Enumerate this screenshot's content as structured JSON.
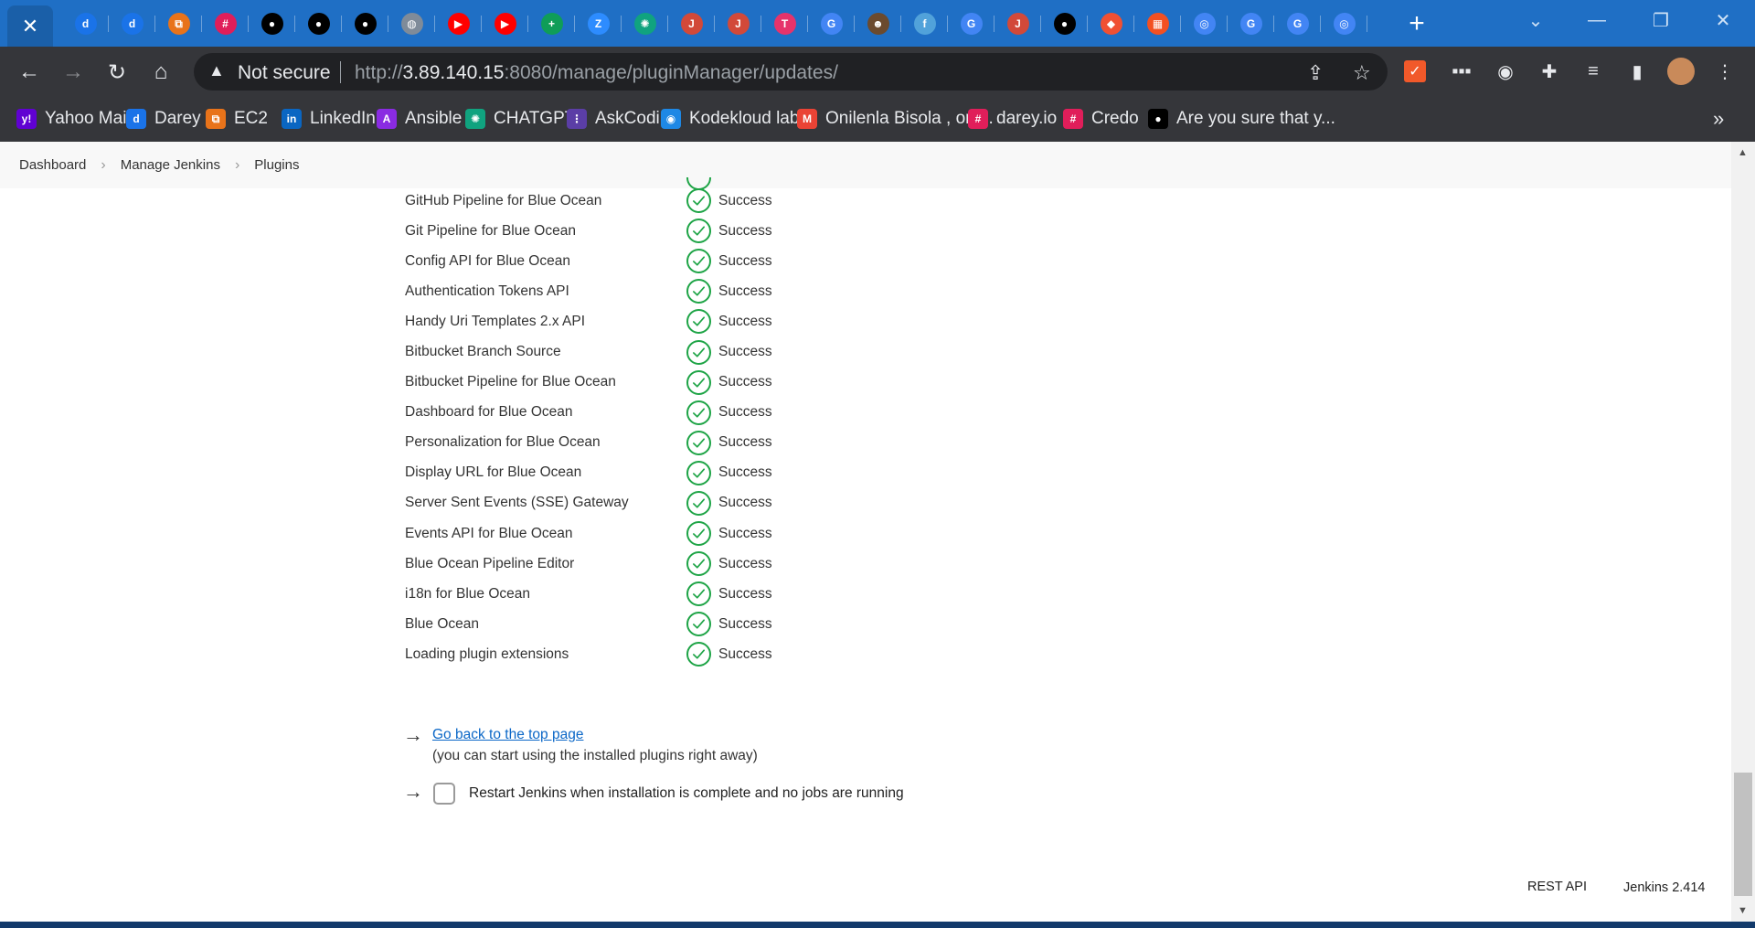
{
  "browser": {
    "active_tab_icon": "close-icon",
    "tabs": [
      {
        "icon": "darey-icon",
        "color": "#1a73e8"
      },
      {
        "icon": "darey-icon",
        "color": "#1a73e8"
      },
      {
        "icon": "aws-ec2-icon",
        "color": "#e8731a"
      },
      {
        "icon": "slack-icon",
        "color": "#e01e5a"
      },
      {
        "icon": "github-icon",
        "color": "#000000"
      },
      {
        "icon": "github-icon",
        "color": "#000000"
      },
      {
        "icon": "github-icon",
        "color": "#000000"
      },
      {
        "icon": "globe-icon",
        "color": "#7f8b99"
      },
      {
        "icon": "youtube-icon",
        "color": "#ff0000"
      },
      {
        "icon": "youtube-icon",
        "color": "#ff0000"
      },
      {
        "icon": "google-sheets-plus-icon",
        "color": "#0f9d58"
      },
      {
        "icon": "zoom-icon",
        "color": "#2d8cff"
      },
      {
        "icon": "chatgpt-icon",
        "color": "#10a37f"
      },
      {
        "icon": "jenkins-icon",
        "color": "#d24939"
      },
      {
        "icon": "jenkins-icon",
        "color": "#d24939"
      },
      {
        "icon": "t-app-icon",
        "color": "#e6336b"
      },
      {
        "icon": "google-icon",
        "color": "#4285f4"
      },
      {
        "icon": "monkey-icon",
        "color": "#6b4a2e"
      },
      {
        "icon": "fedora-icon",
        "color": "#51a2da"
      },
      {
        "icon": "google-icon",
        "color": "#4285f4"
      },
      {
        "icon": "jenkins-icon",
        "color": "#d24939"
      },
      {
        "icon": "github-icon",
        "color": "#000000"
      },
      {
        "icon": "git-icon",
        "color": "#f05033"
      },
      {
        "icon": "microsoft-icon",
        "color": "#f25022"
      },
      {
        "icon": "chrome-icon",
        "color": "#4285f4"
      },
      {
        "icon": "google-icon",
        "color": "#4285f4"
      },
      {
        "icon": "google-icon",
        "color": "#4285f4"
      },
      {
        "icon": "chrome-icon",
        "color": "#4285f4"
      }
    ],
    "security_label": "Not secure",
    "url_prefix": "http://",
    "url_host": "3.89.140.15",
    "url_rest": ":8080/manage/pluginManager/updates/"
  },
  "bookmarks": [
    {
      "label": "Yahoo Mail",
      "icon": "yahoo-icon",
      "color": "#6001d2",
      "glyph": "y!"
    },
    {
      "label": "Darey",
      "icon": "darey-icon",
      "color": "#1a73e8",
      "glyph": "d"
    },
    {
      "label": "EC2",
      "icon": "aws-ec2-icon",
      "color": "#e8731a",
      "glyph": "⧉"
    },
    {
      "label": "LinkedIn",
      "icon": "linkedin-icon",
      "color": "#0a66c2",
      "glyph": "in"
    },
    {
      "label": "Ansible",
      "icon": "ansible-icon",
      "color": "#8a2be2",
      "glyph": "A"
    },
    {
      "label": "CHATGPT",
      "icon": "chatgpt-icon",
      "color": "#10a37f",
      "glyph": "✺"
    },
    {
      "label": "AskCodi",
      "icon": "askcodi-icon",
      "color": "#5b3ea6",
      "glyph": "⋮"
    },
    {
      "label": "Kodekloud labs",
      "icon": "kodekloud-icon",
      "color": "#1e88e5",
      "glyph": "◉"
    },
    {
      "label": "Onilenla Bisola , onl...",
      "icon": "gmail-icon",
      "color": "#ea4335",
      "glyph": "M"
    },
    {
      "label": "darey.io",
      "icon": "slack-icon",
      "color": "#e01e5a",
      "glyph": "#"
    },
    {
      "label": "Credo",
      "icon": "slack-icon",
      "color": "#e01e5a",
      "glyph": "#"
    },
    {
      "label": "Are you sure that y...",
      "icon": "dot-icon",
      "color": "#000000",
      "glyph": "●"
    }
  ],
  "breadcrumb": [
    "Dashboard",
    "Manage Jenkins",
    "Plugins"
  ],
  "plugins": [
    {
      "name": "GitHub Pipeline for Blue Ocean",
      "status": "Success"
    },
    {
      "name": "Git Pipeline for Blue Ocean",
      "status": "Success"
    },
    {
      "name": "Config API for Blue Ocean",
      "status": "Success"
    },
    {
      "name": "Authentication Tokens API",
      "status": "Success"
    },
    {
      "name": "Handy Uri Templates 2.x API",
      "status": "Success"
    },
    {
      "name": "Bitbucket Branch Source",
      "status": "Success"
    },
    {
      "name": "Bitbucket Pipeline for Blue Ocean",
      "status": "Success"
    },
    {
      "name": "Dashboard for Blue Ocean",
      "status": "Success"
    },
    {
      "name": "Personalization for Blue Ocean",
      "status": "Success"
    },
    {
      "name": "Display URL for Blue Ocean",
      "status": "Success"
    },
    {
      "name": "Server Sent Events (SSE) Gateway",
      "status": "Success"
    },
    {
      "name": "Events API for Blue Ocean",
      "status": "Success"
    },
    {
      "name": "Blue Ocean Pipeline Editor",
      "status": "Success"
    },
    {
      "name": "i18n for Blue Ocean",
      "status": "Success"
    },
    {
      "name": "Blue Ocean",
      "status": "Success"
    },
    {
      "name": "Loading plugin extensions",
      "status": "Success"
    }
  ],
  "actions": {
    "go_back_label": "Go back to the top page",
    "go_back_note": "(you can start using the installed plugins right away)",
    "restart_label": "Restart Jenkins when installation is complete and no jobs are running",
    "restart_checked": false
  },
  "footer": {
    "rest_api": "REST API",
    "version": "Jenkins 2.414"
  },
  "colors": {
    "success_green": "#1ea446",
    "link_blue": "#0b67c7",
    "tabstrip_blue": "#1f6fc5"
  }
}
